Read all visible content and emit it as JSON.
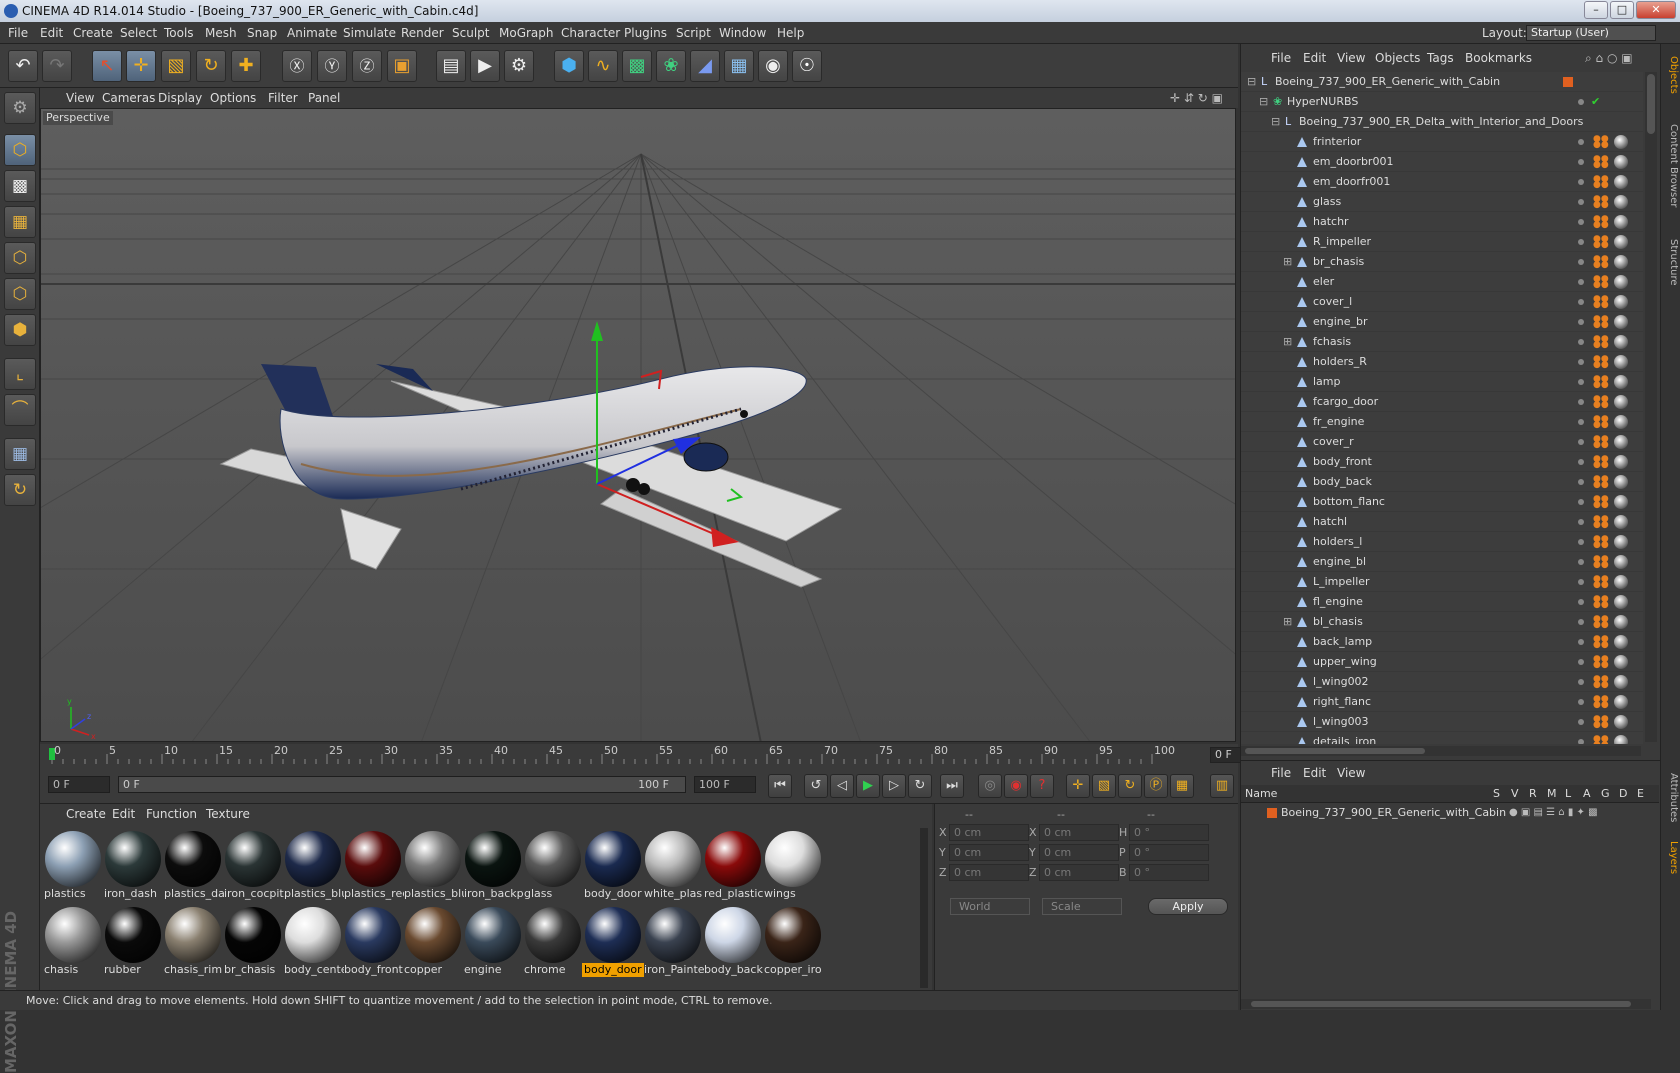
{
  "window": {
    "title": "CINEMA 4D R14.014 Studio - [Boeing_737_900_ER_Generic_with_Cabin.c4d]",
    "btn_min": "–",
    "btn_max": "□",
    "btn_close": "✕"
  },
  "menu": {
    "items": [
      "File",
      "Edit",
      "Create",
      "Select",
      "Tools",
      "Mesh",
      "Snap",
      "Animate",
      "Simulate",
      "Render",
      "Sculpt",
      "MoGraph",
      "Character",
      "Plugins",
      "Script",
      "Window",
      "Help"
    ],
    "layout_label": "Layout:",
    "layout_value": "Startup (User)"
  },
  "viewport": {
    "menu": [
      "View",
      "Cameras",
      "Display",
      "Options",
      "Filter",
      "Panel"
    ],
    "label": "Perspective"
  },
  "timeline": {
    "ticks": [
      "0",
      "5",
      "10",
      "15",
      "20",
      "25",
      "30",
      "35",
      "40",
      "45",
      "50",
      "55",
      "60",
      "65",
      "70",
      "75",
      "80",
      "85",
      "90",
      "95",
      "100"
    ],
    "frame_right": "0 F"
  },
  "transport": {
    "start": "0 F",
    "range_left": "0 F",
    "range_right": "100 F",
    "end": "100 F"
  },
  "materials": {
    "menu": [
      "Create",
      "Edit",
      "Function",
      "Texture"
    ],
    "row1": [
      {
        "name": "plastics",
        "color": "#8da0b4"
      },
      {
        "name": "iron_dash",
        "color": "#2c3a3a"
      },
      {
        "name": "plastics_da",
        "color": "#0c0c0c"
      },
      {
        "name": "iron_cocpit",
        "color": "#2a3434"
      },
      {
        "name": "plastics_blu",
        "color": "#1e2a4a"
      },
      {
        "name": "plastics_rec",
        "color": "#5a0c0c"
      },
      {
        "name": "plastics_blu",
        "color": "#7a7a7a"
      },
      {
        "name": "iron_backp",
        "color": "#0a1410"
      },
      {
        "name": "glass",
        "color": "#5a5a5a"
      },
      {
        "name": "body_door",
        "color": "#1a2a50"
      },
      {
        "name": "white_plas",
        "color": "#bbbbbb"
      },
      {
        "name": "red_plastic",
        "color": "#8a0a0a"
      },
      {
        "name": "wings",
        "color": "#dddddd"
      }
    ],
    "row2": [
      {
        "name": "chasis",
        "color": "#999999"
      },
      {
        "name": "rubber",
        "color": "#0a0a0a"
      },
      {
        "name": "chasis_rim",
        "color": "#8a8070"
      },
      {
        "name": "br_chasis",
        "color": "#050505"
      },
      {
        "name": "body_cente",
        "color": "#dddddd"
      },
      {
        "name": "body_front",
        "color": "#2a3a60"
      },
      {
        "name": "copper",
        "color": "#6a4a30"
      },
      {
        "name": "engine",
        "color": "#3a4a5a"
      },
      {
        "name": "chrome",
        "color": "#3a3a3a"
      },
      {
        "name": "body_door",
        "color": "#1e2e55",
        "selected": true
      },
      {
        "name": "iron_Painte",
        "color": "#3a4250"
      },
      {
        "name": "body_back",
        "color": "#cdd6e6"
      },
      {
        "name": "copper_iro",
        "color": "#3a2418"
      }
    ]
  },
  "attributes": {
    "head": [
      "--",
      "--",
      "--"
    ],
    "rows": [
      {
        "l1": "X",
        "v1": "0 cm",
        "l2": "X",
        "v2": "0 cm",
        "l3": "H",
        "v3": "0 °"
      },
      {
        "l1": "Y",
        "v1": "0 cm",
        "l2": "Y",
        "v2": "0 cm",
        "l3": "P",
        "v3": "0 °"
      },
      {
        "l1": "Z",
        "v1": "0 cm",
        "l2": "Z",
        "v2": "0 cm",
        "l3": "B",
        "v3": "0 °"
      }
    ],
    "coord": "World",
    "mode": "Scale",
    "apply": "Apply"
  },
  "status": "Move: Click and drag to move elements. Hold down SHIFT to quantize movement / add to the selection in point mode, CTRL to remove.",
  "objects": {
    "menu": [
      "File",
      "Edit",
      "View",
      "Objects",
      "Tags",
      "Bookmarks"
    ],
    "root": "Boeing_737_900_ER_Generic_with_Cabin",
    "nurbs": "HyperNURBS",
    "group": "Boeing_737_900_ER_Delta_with_Interior_and_Doors",
    "items": [
      "frinterior",
      "em_doorbr001",
      "em_doorfr001",
      "glass",
      "hatchr",
      "R_impeller",
      "br_chasis",
      "eler",
      "cover_l",
      "engine_br",
      "fchasis",
      "holders_R",
      "lamp",
      "fcargo_door",
      "fr_engine",
      "cover_r",
      "body_front",
      "body_back",
      "bottom_flanc",
      "hatchl",
      "holders_l",
      "engine_bl",
      "L_impeller",
      "fl_engine",
      "bl_chasis",
      "back_lamp",
      "upper_wing",
      "l_wing002",
      "right_flanc",
      "l_wing003",
      "details_iron"
    ],
    "expandable": [
      "br_chasis",
      "fchasis",
      "bl_chasis"
    ]
  },
  "layers": {
    "menu": [
      "File",
      "Edit",
      "View"
    ],
    "header": "Name",
    "cols": [
      "S",
      "V",
      "R",
      "M",
      "L",
      "A",
      "G",
      "D",
      "E"
    ],
    "row": "Boeing_737_900_ER_Generic_with_Cabin"
  },
  "sidetabs": [
    "Objects",
    "Content Browser",
    "Structure",
    "Attributes",
    "Layers"
  ],
  "brand": "MAXON CINEMA 4D"
}
